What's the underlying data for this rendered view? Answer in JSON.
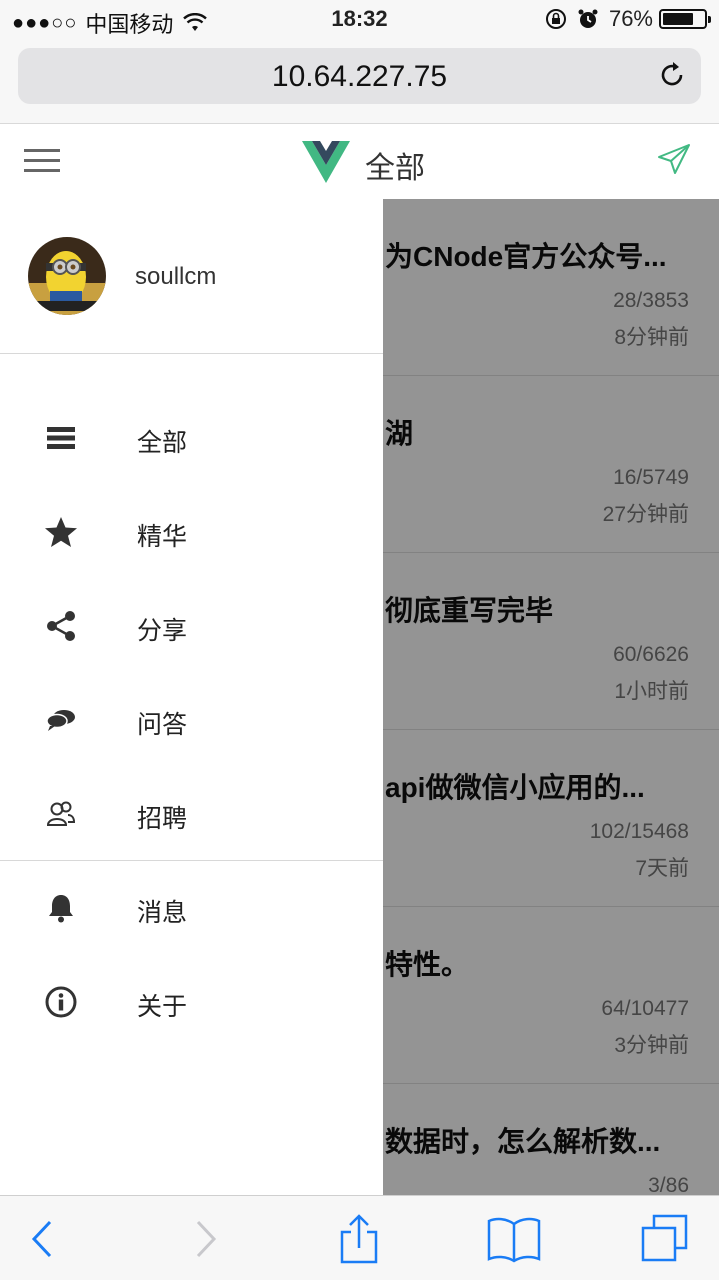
{
  "status": {
    "carrier": "中国移动",
    "time": "18:32",
    "battery": "76%",
    "battery_level": 0.76
  },
  "browser": {
    "url": "10.64.227.75"
  },
  "header": {
    "title": "全部"
  },
  "drawer": {
    "username": "soullcm",
    "items": [
      {
        "label": "全部",
        "icon": "list-icon"
      },
      {
        "label": "精华",
        "icon": "star-icon"
      },
      {
        "label": "分享",
        "icon": "share-icon"
      },
      {
        "label": "问答",
        "icon": "chat-icon"
      },
      {
        "label": "招聘",
        "icon": "people-icon"
      }
    ],
    "secondary": [
      {
        "label": "消息",
        "icon": "bell-icon"
      },
      {
        "label": "关于",
        "icon": "info-icon"
      }
    ]
  },
  "topics": [
    {
      "title": "为CNode官方公众号...",
      "count": "28/3853",
      "time": "8分钟前"
    },
    {
      "title": "湖",
      "count": "16/5749",
      "time": "27分钟前"
    },
    {
      "title": "彻底重写完毕",
      "count": "60/6626",
      "time": "1小时前"
    },
    {
      "title": "api做微信小应用的...",
      "count": "102/15468",
      "time": "7天前"
    },
    {
      "title": "特性。",
      "count": "64/10477",
      "time": "3分钟前"
    },
    {
      "title": "数据时，怎么解析数...",
      "count": "3/86",
      "time": ""
    }
  ]
}
